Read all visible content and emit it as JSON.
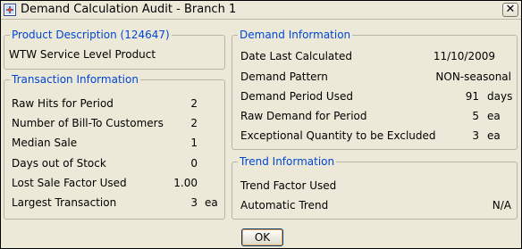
{
  "window": {
    "title": "Demand Calculation Audit - Branch 1",
    "close_glyph": "✕",
    "ok_label": "OK"
  },
  "product": {
    "title": "Product Description (124647)",
    "description": "WTW Service Level Product"
  },
  "transaction": {
    "title": "Transaction Information",
    "rows": [
      {
        "label": "Raw Hits for Period",
        "value": "2",
        "unit": ""
      },
      {
        "label": "Number of Bill-To Customers",
        "value": "2",
        "unit": ""
      },
      {
        "label": "Median Sale",
        "value": "1",
        "unit": ""
      },
      {
        "label": "Days out of Stock",
        "value": "0",
        "unit": ""
      },
      {
        "label": "Lost Sale Factor Used",
        "value": "1.00",
        "unit": ""
      },
      {
        "label": "Largest Transaction",
        "value": "3",
        "unit": "ea"
      }
    ]
  },
  "demand": {
    "title": "Demand Information",
    "rows": [
      {
        "label": "Date Last Calculated",
        "value": "11/10/2009",
        "unit": ""
      },
      {
        "label": "Demand Pattern",
        "value": "NON-seasonal",
        "unit": ""
      },
      {
        "label": "Demand Period Used",
        "value": "91",
        "unit": "days"
      },
      {
        "label": "Raw Demand for Period",
        "value": "5",
        "unit": "ea"
      },
      {
        "label": "Exceptional Quantity to be Excluded",
        "value": "3",
        "unit": "ea"
      }
    ]
  },
  "trend": {
    "title": "Trend Information",
    "rows": [
      {
        "label": "Trend Factor Used",
        "value": "",
        "unit": ""
      },
      {
        "label": "Automatic Trend",
        "value": "N/A",
        "unit": ""
      }
    ]
  }
}
